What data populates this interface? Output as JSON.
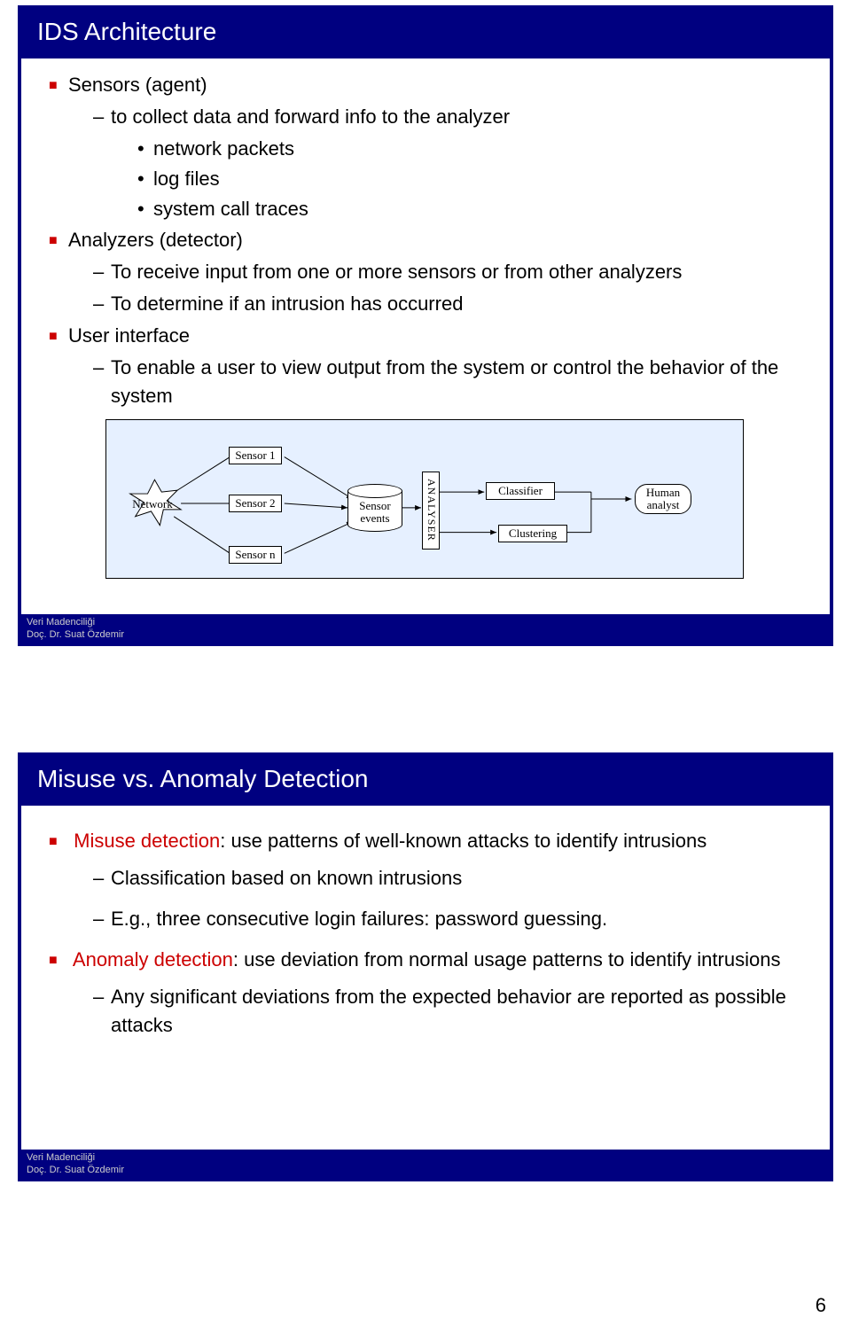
{
  "page_number": "6",
  "slide1": {
    "title": "IDS Architecture",
    "sensors_heading": "Sensors (agent)",
    "sensors_sub": "to collect data and forward info to the analyzer",
    "sensors_items": {
      "a": "network packets",
      "b": "log files",
      "c": "system call traces"
    },
    "analyzers_heading": "Analyzers (detector)",
    "analyzers_sub1": "To receive input from one or more sensors or from other analyzers",
    "analyzers_sub2": "To determine if an intrusion has occurred",
    "ui_heading": "User interface",
    "ui_sub": "To enable a user to view output from the system or control the behavior of the system",
    "diagram": {
      "network": "Network",
      "sensor1": "Sensor 1",
      "sensor2": "Sensor 2",
      "sensorn": "Sensor n",
      "sensor_events": "Sensor\nevents",
      "analyser": "ANALYSER",
      "classifier": "Classifier",
      "clustering": "Clustering",
      "human": "Human\nanalyst"
    },
    "footer1": "Veri Madenciliği",
    "footer2": "Doç. Dr. Suat Özdemir"
  },
  "slide2": {
    "title": "Misuse vs. Anomaly Detection",
    "misuse_lead": "Misuse detection",
    "misuse_rest": ": use patterns of well-known attacks to identify intrusions",
    "misuse_sub1": "Classification based on known intrusions",
    "misuse_sub2": "E.g., three consecutive login failures: password guessing.",
    "anomaly_lead": "Anomaly detection",
    "anomaly_rest": ": use deviation from normal usage patterns to identify intrusions",
    "anomaly_sub": "Any significant deviations from the expected behavior are reported as possible attacks",
    "footer1": "Veri Madenciliği",
    "footer2": "Doç. Dr. Suat Özdemir"
  }
}
